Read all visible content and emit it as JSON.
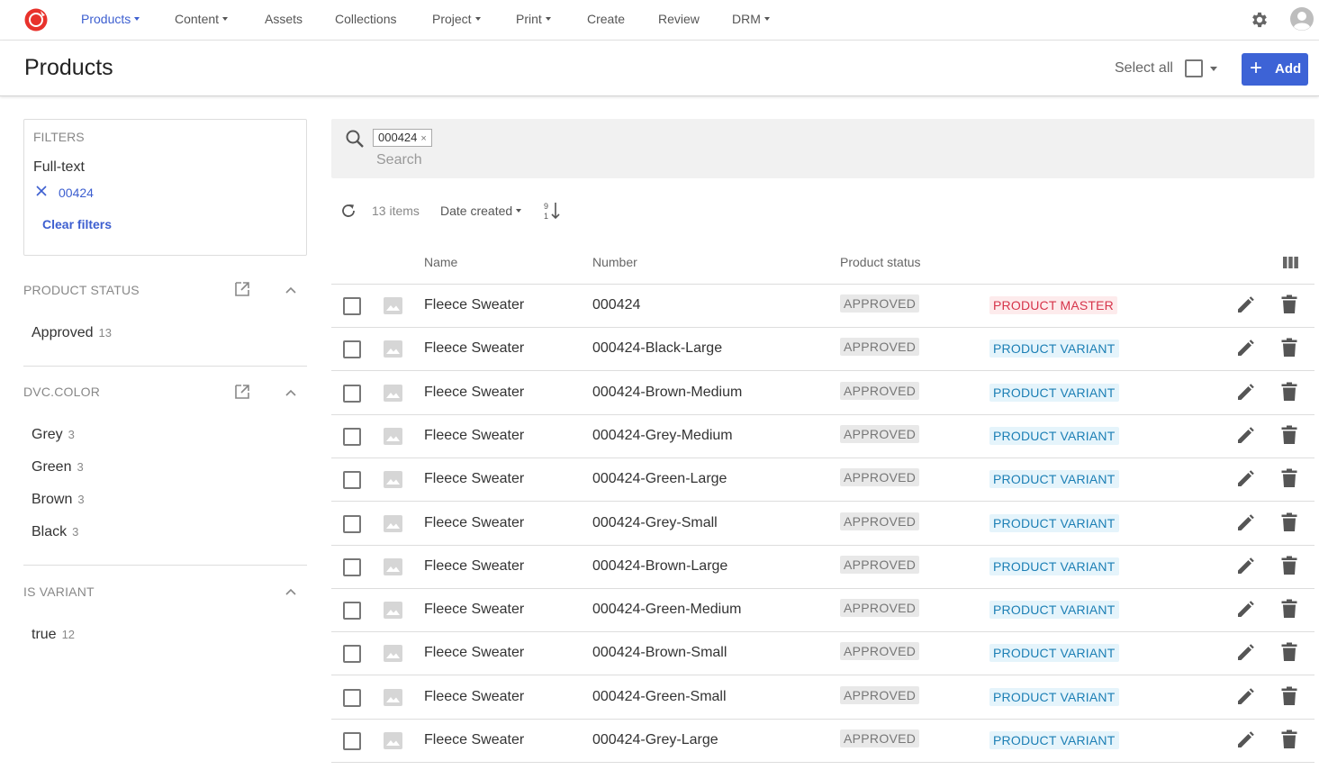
{
  "nav": {
    "items": [
      {
        "label": "Products",
        "dropdown": true,
        "active": true
      },
      {
        "label": "Content",
        "dropdown": true
      },
      {
        "label": "Assets",
        "dropdown": false
      },
      {
        "label": "Collections",
        "dropdown": false
      },
      {
        "label": "Project",
        "dropdown": true
      },
      {
        "label": "Print",
        "dropdown": true
      },
      {
        "label": "Create",
        "dropdown": false
      },
      {
        "label": "Review",
        "dropdown": false
      },
      {
        "label": "DRM",
        "dropdown": true
      }
    ],
    "icons": {
      "logo": "app-logo",
      "settings": "gear-icon",
      "user": "user-avatar-icon"
    }
  },
  "header": {
    "title": "Products",
    "select_all_label": "Select all",
    "add_label": "Add"
  },
  "filters": {
    "heading": "FILTERS",
    "fulltext_label": "Full-text",
    "fulltext_value": "00424",
    "clear_label": "Clear filters"
  },
  "facets": {
    "product_status": {
      "title": "PRODUCT STATUS",
      "items": [
        {
          "label": "Approved",
          "count": "13"
        }
      ]
    },
    "dvc_color": {
      "title": "DVC.COLOR",
      "items": [
        {
          "label": "Grey",
          "count": "3"
        },
        {
          "label": "Green",
          "count": "3"
        },
        {
          "label": "Brown",
          "count": "3"
        },
        {
          "label": "Black",
          "count": "3"
        }
      ]
    },
    "is_variant": {
      "title": "IS VARIANT",
      "items": [
        {
          "label": "true",
          "count": "12"
        }
      ]
    }
  },
  "search": {
    "chip": "000424",
    "placeholder": "Search"
  },
  "toolbar": {
    "items_count": "13 items",
    "sort_field": "Date created"
  },
  "table": {
    "columns": {
      "name": "Name",
      "number": "Number",
      "status": "Product status"
    },
    "rows": [
      {
        "name": "Fleece Sweater",
        "number": "000424",
        "status": "APPROVED",
        "type": "PRODUCT MASTER",
        "kind": "master"
      },
      {
        "name": "Fleece Sweater",
        "number": "000424-Black-Large",
        "status": "APPROVED",
        "type": "PRODUCT VARIANT",
        "kind": "variant"
      },
      {
        "name": "Fleece Sweater",
        "number": "000424-Brown-Medium",
        "status": "APPROVED",
        "type": "PRODUCT VARIANT",
        "kind": "variant"
      },
      {
        "name": "Fleece Sweater",
        "number": "000424-Grey-Medium",
        "status": "APPROVED",
        "type": "PRODUCT VARIANT",
        "kind": "variant"
      },
      {
        "name": "Fleece Sweater",
        "number": "000424-Green-Large",
        "status": "APPROVED",
        "type": "PRODUCT VARIANT",
        "kind": "variant"
      },
      {
        "name": "Fleece Sweater",
        "number": "000424-Grey-Small",
        "status": "APPROVED",
        "type": "PRODUCT VARIANT",
        "kind": "variant"
      },
      {
        "name": "Fleece Sweater",
        "number": "000424-Brown-Large",
        "status": "APPROVED",
        "type": "PRODUCT VARIANT",
        "kind": "variant"
      },
      {
        "name": "Fleece Sweater",
        "number": "000424-Green-Medium",
        "status": "APPROVED",
        "type": "PRODUCT VARIANT",
        "kind": "variant"
      },
      {
        "name": "Fleece Sweater",
        "number": "000424-Brown-Small",
        "status": "APPROVED",
        "type": "PRODUCT VARIANT",
        "kind": "variant"
      },
      {
        "name": "Fleece Sweater",
        "number": "000424-Green-Small",
        "status": "APPROVED",
        "type": "PRODUCT VARIANT",
        "kind": "variant"
      },
      {
        "name": "Fleece Sweater",
        "number": "000424-Grey-Large",
        "status": "APPROVED",
        "type": "PRODUCT VARIANT",
        "kind": "variant"
      }
    ]
  },
  "colors": {
    "accent": "#3d5fd0",
    "add_button": "#3d63d6",
    "master_text": "#d6344a",
    "master_bg": "#fdebec",
    "variant_text": "#1c7fb5",
    "variant_bg": "#e5f4fb",
    "status_bg": "#e8e8e8"
  }
}
